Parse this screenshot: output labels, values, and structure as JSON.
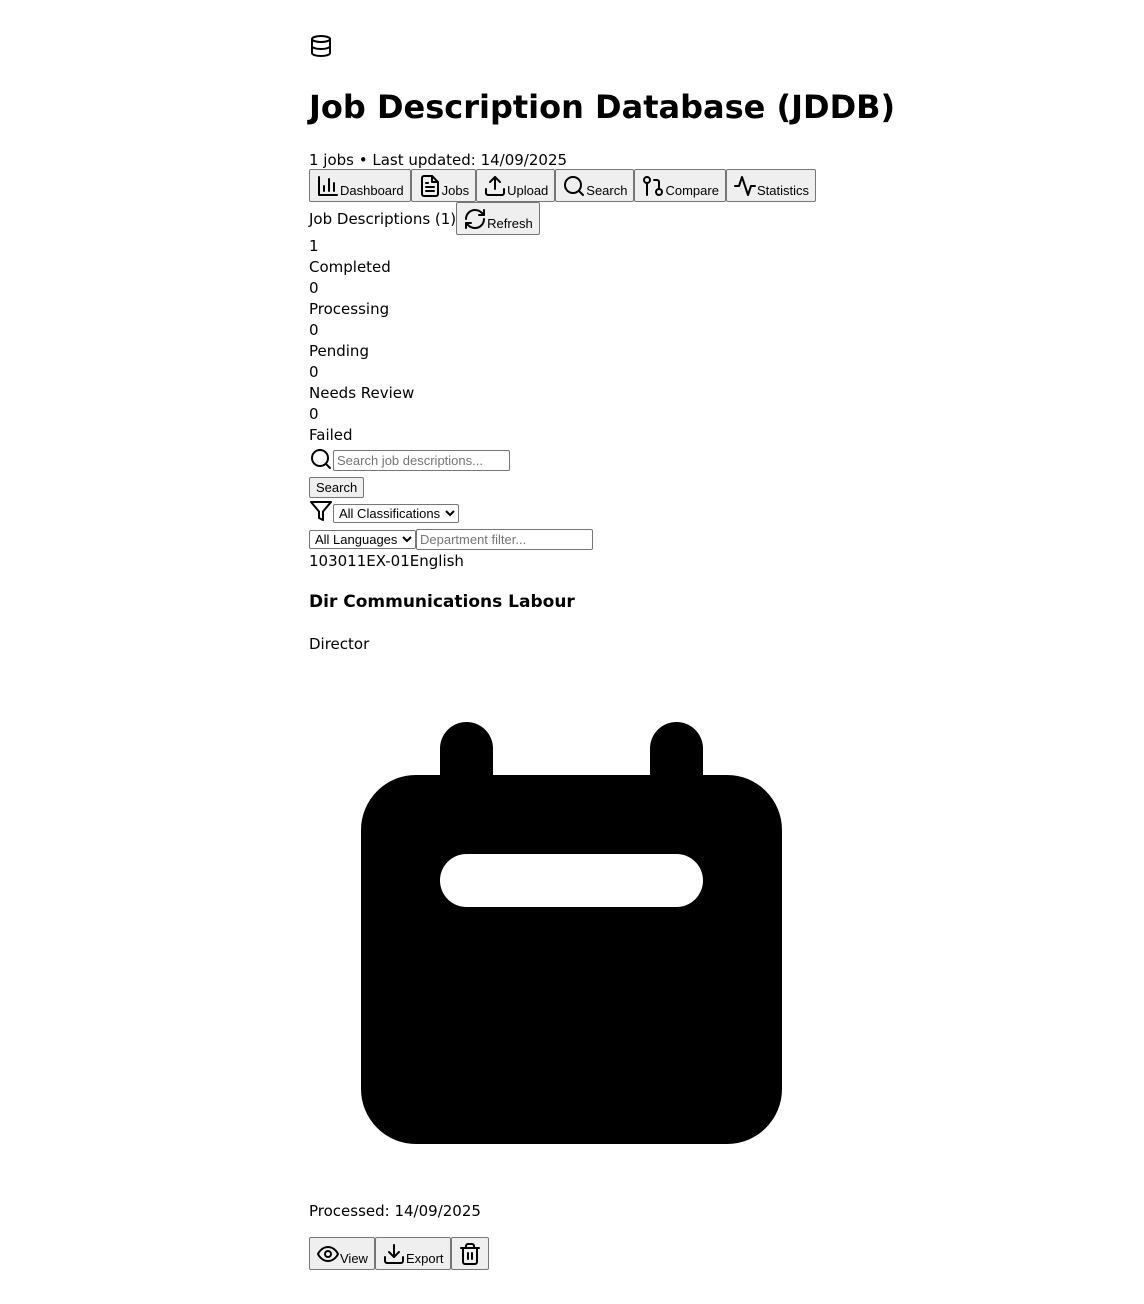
{
  "header": {
    "logo_icon": "database-icon",
    "title": "Job Description Database (JDDB)",
    "meta": "1 jobs • Last updated: 14/09/2025"
  },
  "nav": [
    {
      "label": "Dashboard",
      "icon": "bar-chart-icon"
    },
    {
      "label": "Jobs",
      "icon": "file-text-icon"
    },
    {
      "label": "Upload",
      "icon": "upload-icon"
    },
    {
      "label": "Search",
      "icon": "search-icon"
    },
    {
      "label": "Compare",
      "icon": "git-compare-icon"
    },
    {
      "label": "Statistics",
      "icon": "activity-icon"
    }
  ],
  "list": {
    "title": "Job Descriptions (1)",
    "refresh_label": "Refresh"
  },
  "stats": [
    {
      "value": "1",
      "label": "Completed"
    },
    {
      "value": "0",
      "label": "Processing"
    },
    {
      "value": "0",
      "label": "Pending"
    },
    {
      "value": "0",
      "label": "Needs Review"
    },
    {
      "value": "0",
      "label": "Failed"
    }
  ],
  "search": {
    "placeholder": "Search job descriptions...",
    "button_label": "Search"
  },
  "filters": {
    "classification_selected": "All Classifications",
    "language_selected": "All Languages",
    "department_placeholder": "Department filter..."
  },
  "job": {
    "id": "103011EX-01",
    "language": "English",
    "title": "Dir Communications Labour",
    "level": "Director",
    "icon": "calendar-icon",
    "processed": "Processed: 14/09/2025",
    "actions": {
      "view_label": "View",
      "export_label": "Export",
      "delete_icon": "trash-icon"
    }
  }
}
